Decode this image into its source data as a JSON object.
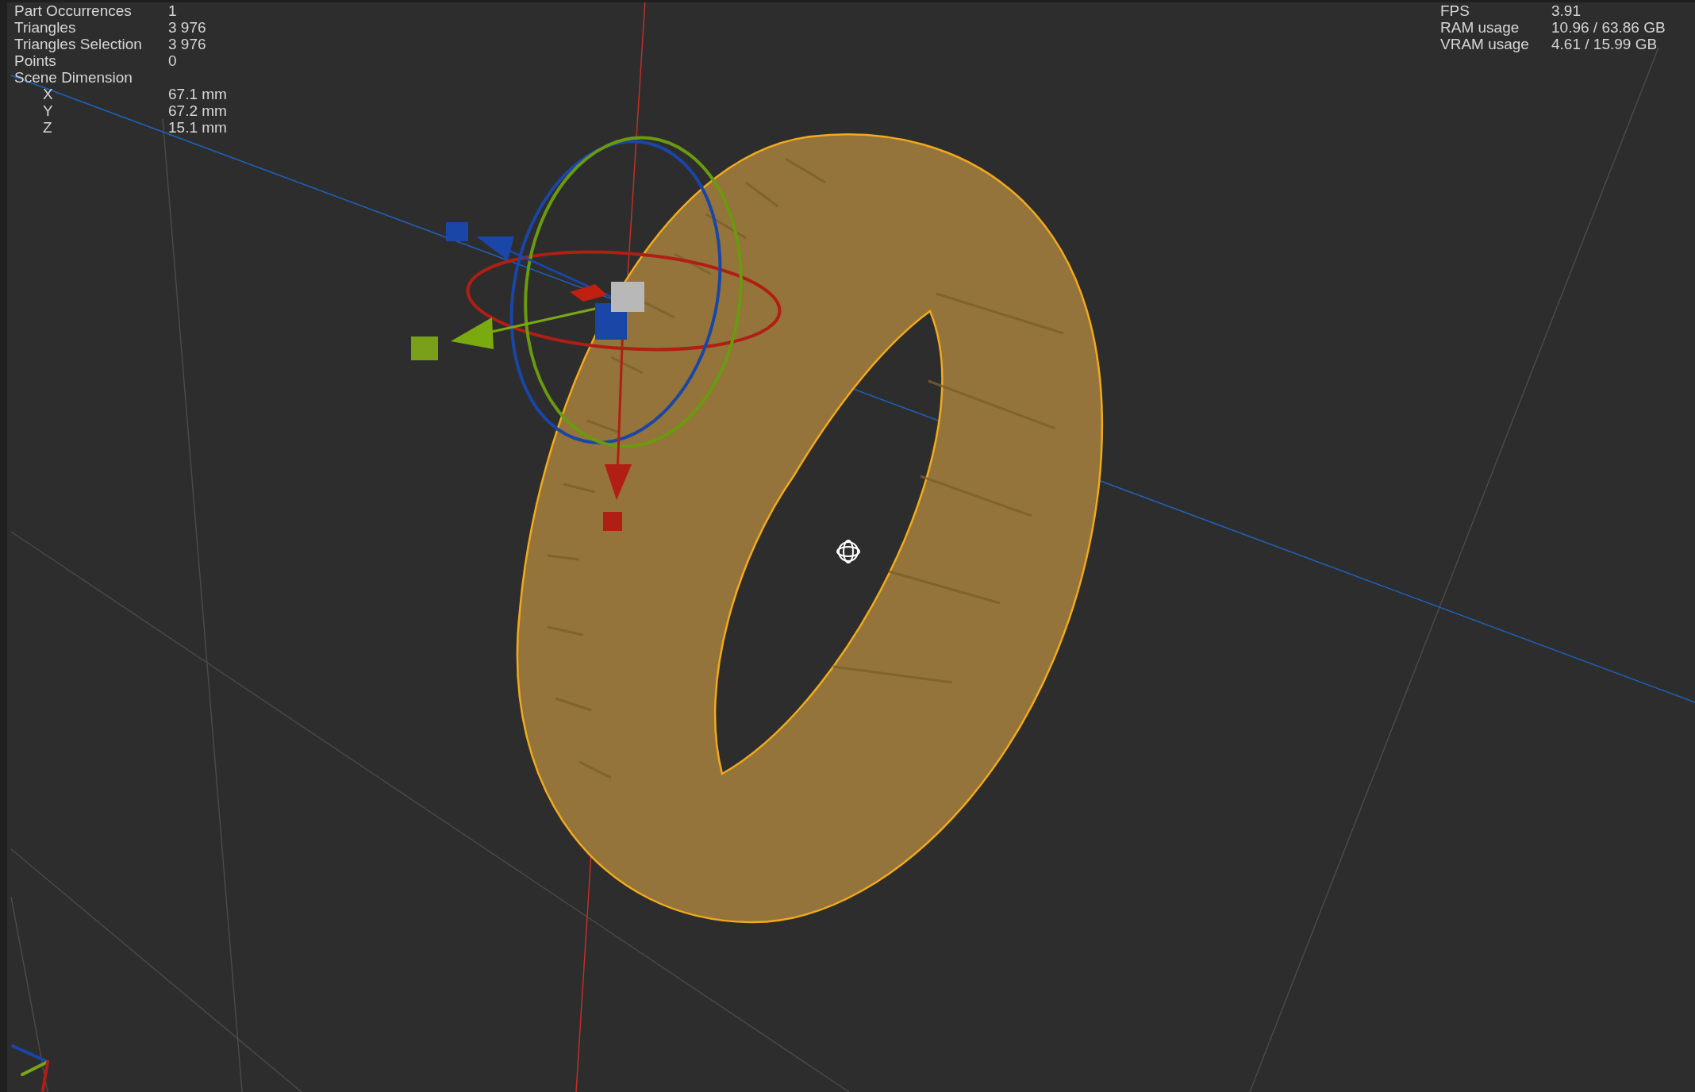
{
  "scene_stats": [
    {
      "label": "Part Occurrences",
      "value": "1"
    },
    {
      "label": "Triangles",
      "value": "3 976"
    },
    {
      "label": "Triangles Selection",
      "value": "3 976"
    },
    {
      "label": "Points",
      "value": "0"
    }
  ],
  "scene_dimension": {
    "label": "Scene Dimension",
    "axes": [
      {
        "label": "X",
        "value": "67.1 mm"
      },
      {
        "label": "Y",
        "value": "67.2 mm"
      },
      {
        "label": "Z",
        "value": "15.1 mm"
      }
    ]
  },
  "performance": [
    {
      "label": "FPS",
      "value": "3.91"
    },
    {
      "label": "RAM usage",
      "value": "10.96 / 63.86 GB"
    },
    {
      "label": "VRAM usage",
      "value": "4.61 / 15.99 GB"
    }
  ]
}
